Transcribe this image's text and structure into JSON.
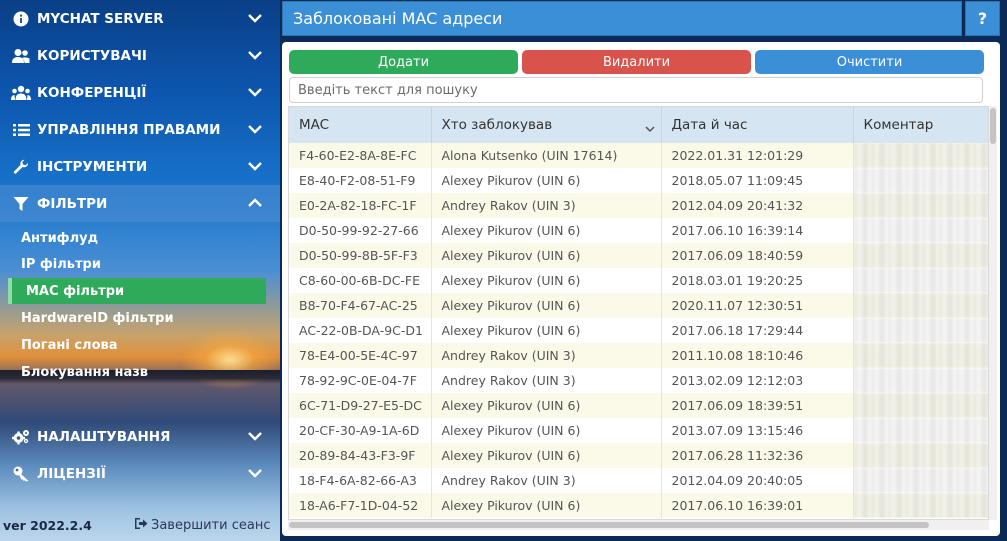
{
  "sidebar": {
    "menu": [
      {
        "label": "MYCHAT SERVER",
        "icon": "info-icon"
      },
      {
        "label": "КОРИСТУВАЧІ",
        "icon": "users-icon"
      },
      {
        "label": "КОНФЕРЕНЦІЇ",
        "icon": "group-icon"
      },
      {
        "label": "УПРАВЛІННЯ ПРАВАМИ",
        "icon": "list-icon"
      },
      {
        "label": "ІНСТРУМЕНТИ",
        "icon": "wrench-icon"
      },
      {
        "label": "ФІЛЬТРИ",
        "icon": "filter-icon"
      }
    ],
    "filters_sub": [
      {
        "label": "Антифлуд"
      },
      {
        "label": "IP фільтри"
      },
      {
        "label": "MAC фільтри"
      },
      {
        "label": "HardwareID фільтри"
      },
      {
        "label": "Погані слова"
      },
      {
        "label": "Блокування назв"
      }
    ],
    "bottom_menu": [
      {
        "label": "НАЛАШТУВАННЯ",
        "icon": "gears-icon"
      },
      {
        "label": "ЛІЦЕНЗІЇ",
        "icon": "key-icon"
      }
    ],
    "version": "ver 2022.2.4",
    "logout_label": "Завершити сеанс"
  },
  "header": {
    "title": "Заблоковані MAC адреси",
    "help_label": "?"
  },
  "toolbar": {
    "add_label": "Додати",
    "delete_label": "Видалити",
    "clear_label": "Очистити"
  },
  "search": {
    "placeholder": "Введіть текст для пошуку"
  },
  "table": {
    "columns": [
      "MAC",
      "Хто заблокував",
      "Дата й час",
      "Коментар"
    ],
    "rows": [
      [
        "F4-60-E2-8A-8E-FC",
        "Alona Kutsenko (UIN 17614)",
        "2022.01.31 12:01:29"
      ],
      [
        "E8-40-F2-08-51-F9",
        "Alexey Pikurov (UIN 6)",
        "2018.05.07 11:09:45"
      ],
      [
        "E0-2A-82-18-FC-1F",
        "Andrey Rakov (UIN 3)",
        "2012.04.09 20:41:32"
      ],
      [
        "D0-50-99-92-27-66",
        "Alexey Pikurov (UIN 6)",
        "2017.06.10 16:39:14"
      ],
      [
        "D0-50-99-8B-5F-F3",
        "Alexey Pikurov (UIN 6)",
        "2017.06.09 18:40:59"
      ],
      [
        "C8-60-00-6B-DC-FE",
        "Alexey Pikurov (UIN 6)",
        "2018.03.01 19:20:25"
      ],
      [
        "B8-70-F4-67-AC-25",
        "Alexey Pikurov (UIN 6)",
        "2020.11.07 12:30:51"
      ],
      [
        "AC-22-0B-DA-9C-D1",
        "Alexey Pikurov (UIN 6)",
        "2017.06.18 17:29:44"
      ],
      [
        "78-E4-00-5E-4C-97",
        "Andrey Rakov (UIN 3)",
        "2011.10.08 18:10:46"
      ],
      [
        "78-92-9C-0E-04-7F",
        "Andrey Rakov (UIN 3)",
        "2013.02.09 12:12:03"
      ],
      [
        "6C-71-D9-27-E5-DC",
        "Alexey Pikurov (UIN 6)",
        "2017.06.09 18:39:51"
      ],
      [
        "20-CF-30-A9-1A-6D",
        "Alexey Pikurov (UIN 6)",
        "2013.07.09 13:15:46"
      ],
      [
        "20-89-84-43-F3-9F",
        "Alexey Pikurov (UIN 6)",
        "2017.06.28 11:32:36"
      ],
      [
        "18-F4-6A-82-66-A3",
        "Andrey Rakov (UIN 3)",
        "2012.04.09 20:40:05"
      ],
      [
        "18-A6-F7-1D-04-52",
        "Alexey Pikurov (UIN 6)",
        "2017.06.10 16:39:01"
      ]
    ]
  },
  "colors": {
    "accent_blue": "#3a8fd6",
    "add_green": "#2faa5a",
    "delete_red": "#d8534b",
    "selected_green": "#2faa5a"
  }
}
